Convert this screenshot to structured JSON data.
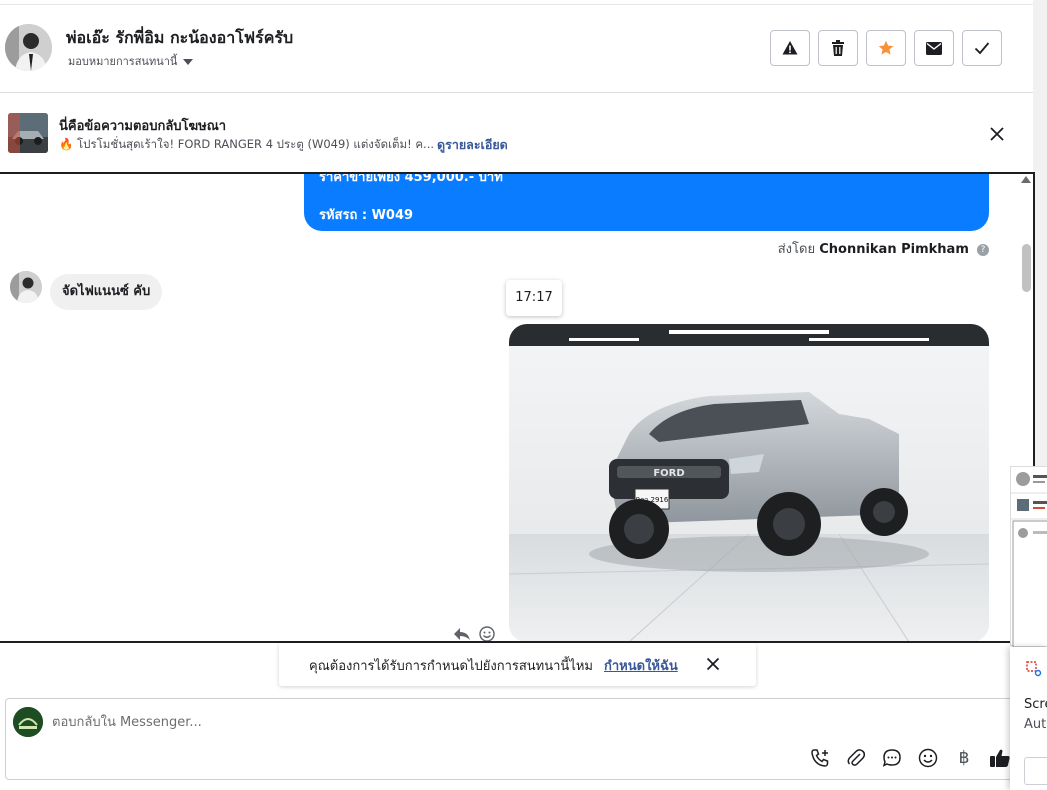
{
  "header": {
    "name": "พ่อเอ๊ะ รักพี่อิม กะน้องอาโฟร์ครับ",
    "assign_label": "มอบหมายการสนทนานี้",
    "actions": [
      {
        "icon": "warning-icon"
      },
      {
        "icon": "trash-icon"
      },
      {
        "icon": "star-icon",
        "color": "#f7923b"
      },
      {
        "icon": "envelope-icon"
      },
      {
        "icon": "check-icon"
      }
    ]
  },
  "ad_banner": {
    "title": "นี่คือข้อความตอบกลับโฆษณา",
    "subtitle": "🔥 โปรโมชั่นสุดเร้าใจ! FORD RANGER 4 ประตู (W049) แต่งจัดเต็ม! ค...",
    "link": "ดูรายละเอียด"
  },
  "conversation": {
    "outgoing_lines": [
      "ราคาขายเพียง 459,000.- บาท",
      "รหัสรถ : W049"
    ],
    "sent_by_prefix": "ส่งโดย",
    "sent_by_name": "Chonnikan Pimkham",
    "incoming_text": "จัดไฟแนนซ์ คับ",
    "time": "17:17",
    "photo_plate": "9กว 2916",
    "photo_brand": "FORD"
  },
  "prompt": {
    "text": "คุณต้องการได้รับการกำหนดไปยังการสนทนานี้ไหม",
    "link": "กำหนดให้ฉัน"
  },
  "composer": {
    "placeholder": "ตอบกลับใน Messenger...",
    "baht": "฿"
  },
  "side_panel": {
    "text1": "Scre",
    "text2": "Aut"
  },
  "colors": {
    "accent_blue": "#0a7cff",
    "link_blue": "#385898",
    "star_orange": "#f7923b"
  }
}
